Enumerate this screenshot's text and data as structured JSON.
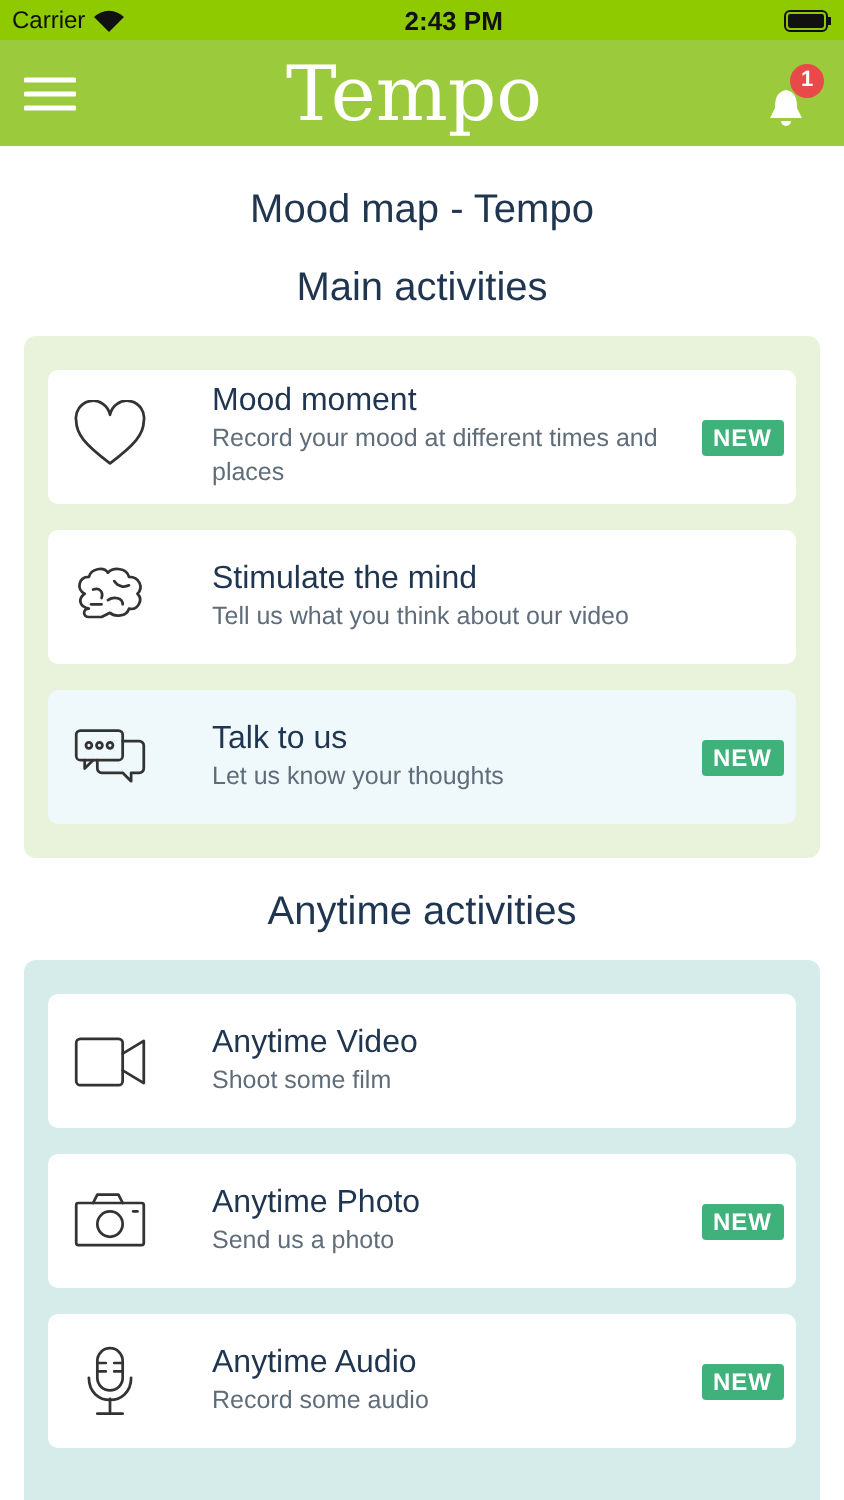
{
  "status_bar": {
    "carrier": "Carrier",
    "time": "2:43 PM"
  },
  "nav_bar": {
    "title": "Tempo",
    "notification_count": "1"
  },
  "page_title": "Mood map - Tempo",
  "sections": [
    {
      "title": "Main activities",
      "kind": "main",
      "items": [
        {
          "kind": "heart",
          "title": "Mood moment",
          "subtitle": "Record your mood at different times and places",
          "badge": "NEW",
          "selected": false
        },
        {
          "kind": "brain",
          "title": "Stimulate the mind",
          "subtitle": "Tell us what you think about our video",
          "selected": false
        },
        {
          "kind": "chat",
          "title": "Talk to us",
          "subtitle": "Let us know your thoughts",
          "badge": "NEW",
          "selected": true
        }
      ]
    },
    {
      "title": "Anytime activities",
      "kind": "anytime",
      "items": [
        {
          "kind": "video",
          "title": "Anytime Video",
          "subtitle": "Shoot some film",
          "selected": false
        },
        {
          "kind": "camera",
          "title": "Anytime Photo",
          "subtitle": "Send us a photo",
          "badge": "NEW",
          "selected": false
        },
        {
          "kind": "mic",
          "title": "Anytime Audio",
          "subtitle": "Record some audio",
          "badge": "NEW",
          "selected": false
        }
      ]
    }
  ]
}
